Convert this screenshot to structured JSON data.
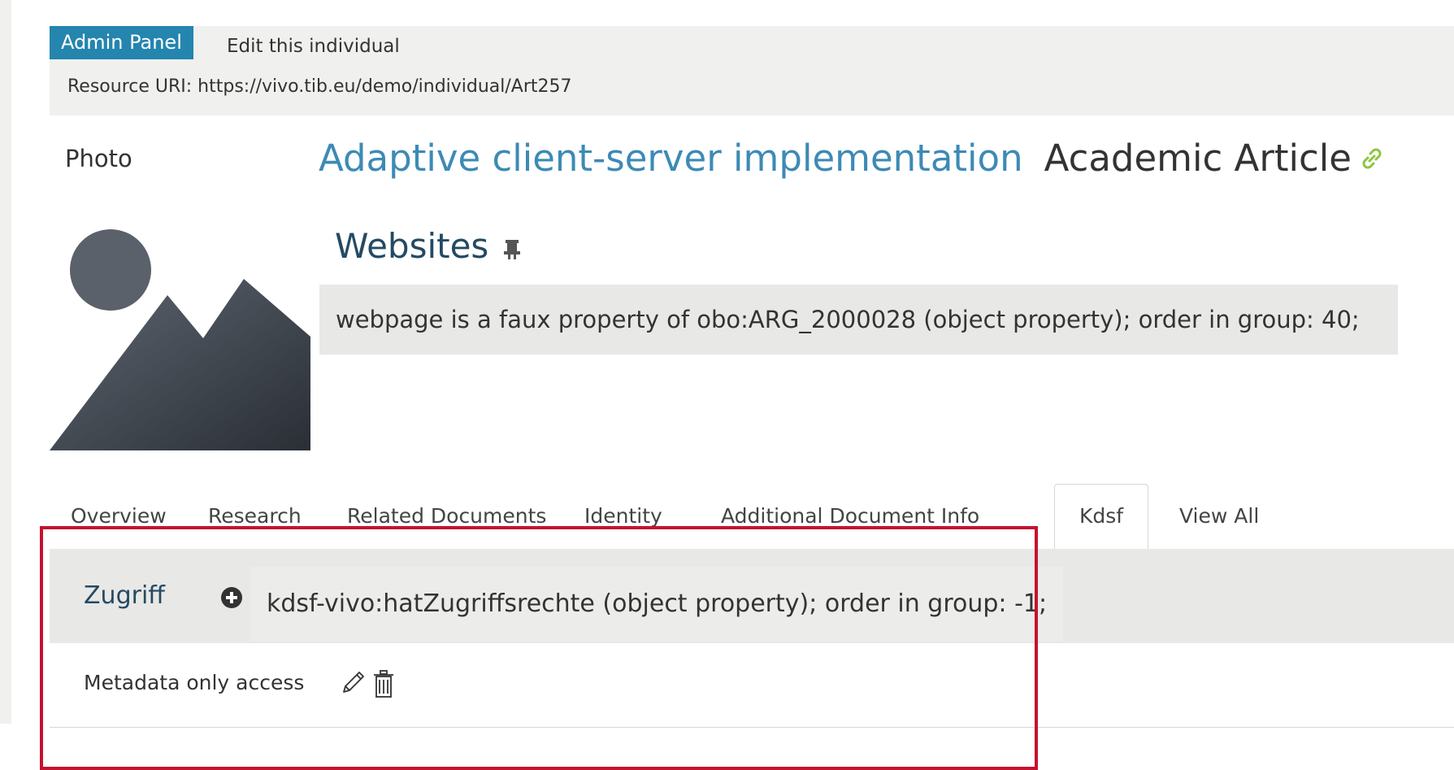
{
  "admin_panel": {
    "badge": "Admin Panel",
    "edit_link": "Edit this individual",
    "resource_uri": "Resource URI: https://vivo.tib.eu/demo/individual/Art257"
  },
  "photo": {
    "label": "Photo",
    "icon": "image-placeholder-icon"
  },
  "individual": {
    "title": "Adaptive client-server implementation",
    "type": "Academic Article",
    "link_icon": "link-icon"
  },
  "websites": {
    "title": "Websites",
    "icon": "pin-icon",
    "faux_property_note": "webpage is a faux property of obo:ARG_2000028 (object property); order in group: 40;"
  },
  "tabs": [
    {
      "label": "Overview",
      "active": false
    },
    {
      "label": "Research",
      "active": false
    },
    {
      "label": "Related Documents",
      "active": false
    },
    {
      "label": "Identity",
      "active": false
    },
    {
      "label": "Additional Document Info",
      "active": false
    },
    {
      "label": "Kdsf",
      "active": true
    },
    {
      "label": "View All",
      "active": false
    }
  ],
  "property_group": {
    "name": "Zugriff",
    "add_icon": "plus-circle-icon",
    "info": "kdsf-vivo:hatZugriffsrechte (object property); order in group: -1;",
    "value": "Metadata only access",
    "edit_icon": "pencil-icon",
    "delete_icon": "trash-icon"
  },
  "colors": {
    "admin_badge": "#2485ae",
    "title": "#3d8ab5",
    "heading": "#244a63",
    "link_icon": "#8cc63f",
    "highlight": "#c4122f",
    "panel_bg": "#f0f0ee"
  }
}
